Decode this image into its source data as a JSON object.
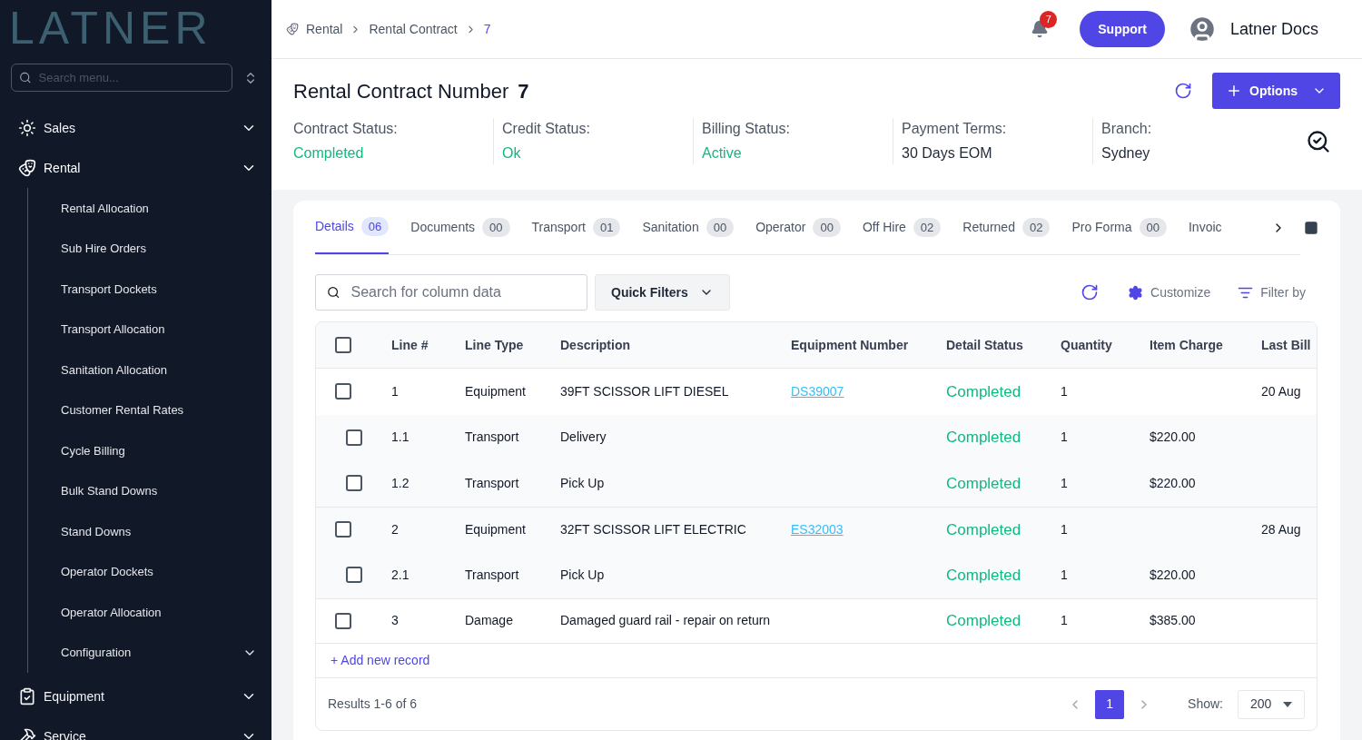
{
  "logo": "LATNER",
  "sidebar": {
    "search": {
      "placeholder": "Search menu..."
    },
    "items": [
      {
        "label": "Sales",
        "expanded": false
      },
      {
        "label": "Rental",
        "expanded": true,
        "children": [
          {
            "label": "Rental Allocation"
          },
          {
            "label": "Sub Hire Orders"
          },
          {
            "label": "Transport Dockets"
          },
          {
            "label": "Transport Allocation"
          },
          {
            "label": "Sanitation Allocation"
          },
          {
            "label": "Customer Rental Rates"
          },
          {
            "label": "Cycle Billing"
          },
          {
            "label": "Bulk Stand Downs"
          },
          {
            "label": "Stand Downs"
          },
          {
            "label": "Operator Dockets"
          },
          {
            "label": "Operator Allocation"
          },
          {
            "label": "Configuration",
            "expandable": true
          }
        ]
      },
      {
        "label": "Equipment",
        "expanded": false
      },
      {
        "label": "Service",
        "expanded": false
      }
    ]
  },
  "breadcrumb": [
    "Rental",
    "Rental Contract",
    "7"
  ],
  "notifications": {
    "count": "7"
  },
  "support_button": "Support",
  "user": {
    "name": "Latner Docs"
  },
  "title": {
    "label": "Rental Contract Number",
    "number": "7"
  },
  "options_button": "Options",
  "info": [
    {
      "label": "Contract Status:",
      "value": "Completed",
      "kind": "status"
    },
    {
      "label": "Credit Status:",
      "value": "Ok",
      "kind": "status"
    },
    {
      "label": "Billing Status:",
      "value": "Active",
      "kind": "status"
    },
    {
      "label": "Payment Terms:",
      "value": "30 Days EOM",
      "kind": "plain"
    },
    {
      "label": "Branch:",
      "value": "Sydney",
      "kind": "plain"
    }
  ],
  "tabs": [
    {
      "label": "Details",
      "count": "06",
      "selected": true
    },
    {
      "label": "Documents",
      "count": "00",
      "selected": false
    },
    {
      "label": "Transport",
      "count": "01",
      "selected": false
    },
    {
      "label": "Sanitation",
      "count": "00",
      "selected": false
    },
    {
      "label": "Operator",
      "count": "00",
      "selected": false
    },
    {
      "label": "Off Hire",
      "count": "02",
      "selected": false
    },
    {
      "label": "Returned",
      "count": "02",
      "selected": false
    },
    {
      "label": "Pro Forma",
      "count": "00",
      "selected": false
    },
    {
      "label": "Invoic",
      "selected": false
    }
  ],
  "table_search": {
    "placeholder": "Search for column data"
  },
  "quick_filters": "Quick Filters",
  "customize": "Customize",
  "filter_by": "Filter by",
  "table": {
    "header_checked": false,
    "columns": [
      "Line #",
      "Line Type",
      "Description",
      "Equipment Number",
      "Detail Status",
      "Quantity",
      "Item Charge",
      "Last Bill"
    ],
    "rows": [
      {
        "kind": "parent",
        "checked": false,
        "line": "1",
        "type": "Equipment",
        "description": "39FT SCISSOR LIFT DIESEL",
        "equipment": "DS39007",
        "status": "Completed",
        "quantity": "1",
        "last_bill": "20 Aug"
      },
      {
        "kind": "child",
        "checked": false,
        "line": "1.1",
        "type": "Transport",
        "description": "Delivery",
        "status": "Completed",
        "quantity": "1",
        "charge": "$220.00"
      },
      {
        "kind": "child",
        "checked": false,
        "line": "1.2",
        "type": "Transport",
        "description": "Pick Up",
        "status": "Completed",
        "quantity": "1",
        "charge": "$220.00"
      },
      {
        "kind": "parent",
        "checked": false,
        "line": "2",
        "type": "Equipment",
        "description": "32FT SCISSOR LIFT ELECTRIC",
        "equipment": "ES32003",
        "status": "Completed",
        "quantity": "1",
        "last_bill": "28 Aug"
      },
      {
        "kind": "child",
        "checked": false,
        "line": "2.1",
        "type": "Transport",
        "description": "Pick Up",
        "status": "Completed",
        "quantity": "1",
        "charge": "$220.00"
      },
      {
        "kind": "single",
        "checked": false,
        "line": "3",
        "type": "Damage",
        "description": "Damaged guard rail - repair on return",
        "status": "Completed",
        "quantity": "1",
        "charge": "$385.00"
      }
    ],
    "add_record": "+ Add new record"
  },
  "footer": {
    "results": "Results 1-6 of 6",
    "pages": [
      {
        "label": "1",
        "selected": true
      }
    ],
    "show_label": "Show:",
    "show_value": "200"
  }
}
